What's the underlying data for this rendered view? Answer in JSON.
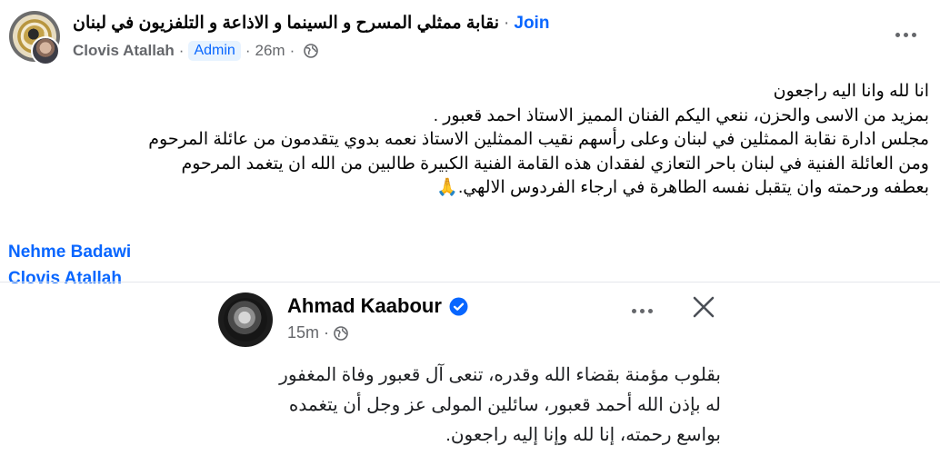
{
  "header": {
    "group_name": "نقابة ممثلي المسرح و السينما و الاذاعة و التلفزيون في لبنان",
    "separator": "·",
    "join_label": "Join",
    "author": "Clovis Atallah",
    "badge": "Admin",
    "time": "26m"
  },
  "post": {
    "lines": [
      "انا لله وانا اليه راجعون",
      "بمزيد من الاسى والحزن، ننعي اليكم الفنان المميز الاستاذ احمد قعبور .",
      "مجلس ادارة نقابة الممثلين في لبنان وعلى رأسهم نقيب الممثلين الاستاذ نعمه بدوي يتقدمون من عائلة المرحوم",
      "ومن العائلة الفنية في لبنان باحر التعازي لفقدان هذه القامة الفنية الكبيرة طالبين من الله ان يتغمد المرحوم",
      "بعطفه ورحمته وان يتقبل نفسه الطاهرة في ارجاء الفردوس الالهي.🙏"
    ],
    "tags": [
      "Nehme Badawi",
      "Clovis Atallah"
    ]
  },
  "shared_post": {
    "name": "Ahmad Kaabour",
    "time": "15m",
    "lines": [
      "بقلوب مؤمنة بقضاء الله وقدره، تنعى آل قعبور وفاة المغفور",
      "له بإذن الله أحمد قعبور، سائلين المولى عز وجل أن يتغمده",
      "بواسع رحمته، إنا لله وإنا إليه راجعون."
    ]
  },
  "icons": {
    "audience": "globe-icon",
    "verified": "verified-badge-icon",
    "more": "more-options-icon",
    "close": "close-icon"
  },
  "colors": {
    "link": "#0866ff",
    "meta_text": "#65676b",
    "badge_bg": "#e7f3ff"
  }
}
